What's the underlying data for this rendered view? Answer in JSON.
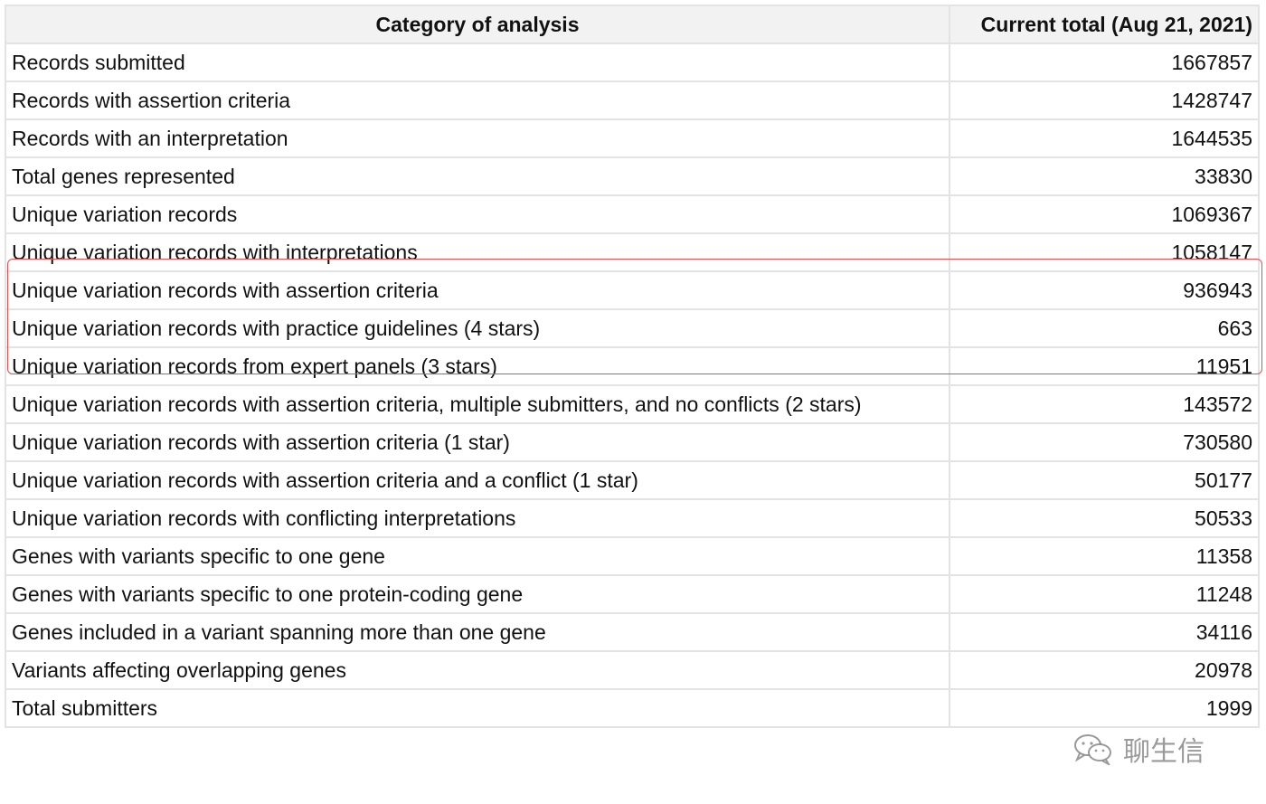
{
  "table": {
    "headers": [
      "Category of analysis",
      "Current total (Aug 21, 2021)"
    ],
    "rows": [
      {
        "label": "Records submitted",
        "value": "1667857"
      },
      {
        "label": "Records with assertion criteria",
        "value": "1428747"
      },
      {
        "label": "Records with an interpretation",
        "value": "1644535"
      },
      {
        "label": "Total genes represented",
        "value": "33830"
      },
      {
        "label": "Unique variation records",
        "value": "1069367"
      },
      {
        "label": "Unique variation records with interpretations",
        "value": "1058147"
      },
      {
        "label": "Unique variation records with assertion criteria",
        "value": "936943"
      },
      {
        "label": "Unique variation records with practice guidelines (4 stars)",
        "value": "663"
      },
      {
        "label": "Unique variation records from expert panels (3 stars)",
        "value": "11951"
      },
      {
        "label": "Unique variation records with assertion criteria, multiple submitters, and no conflicts (2 stars)",
        "value": "143572"
      },
      {
        "label": "Unique variation records with assertion criteria (1 star)",
        "value": "730580"
      },
      {
        "label": "Unique variation records with assertion criteria and a conflict (1 star)",
        "value": "50177"
      },
      {
        "label": "Unique variation records with conflicting interpretations",
        "value": "50533"
      },
      {
        "label": "Genes with variants specific to one gene",
        "value": "11358"
      },
      {
        "label": "Genes with variants specific to one protein-coding gene",
        "value": "11248"
      },
      {
        "label": "Genes included in a variant spanning more than one gene",
        "value": "34116"
      },
      {
        "label": "Variants affecting overlapping genes",
        "value": "20978"
      },
      {
        "label": "Total submitters",
        "value": "1999"
      }
    ]
  },
  "highlight": {
    "color": "#e05050"
  },
  "watermark": {
    "text": "聊生信",
    "icon": "wechat-icon"
  }
}
